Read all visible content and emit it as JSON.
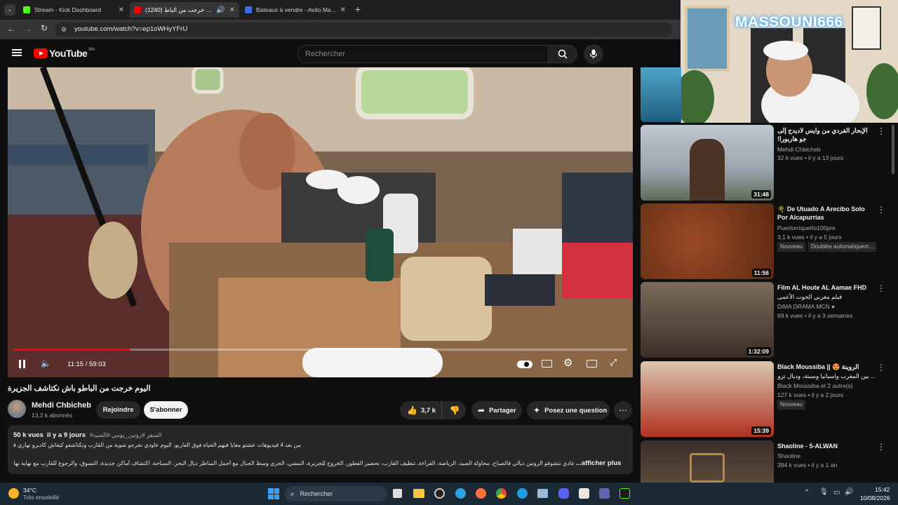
{
  "browser": {
    "tabs": [
      {
        "title": "Stream - Kick Dashboard",
        "favicon_color": "#53fc18"
      },
      {
        "title": "اليوم خرجت من الباط (1240)",
        "favicon_color": "#ff0000"
      },
      {
        "title": "Bateaux à vendre - Avito Maroc",
        "favicon_color": "#3a6df0"
      }
    ],
    "url": "youtube.com/watch?v=ep1oWHyYFrU"
  },
  "youtube": {
    "logo": "YouTube",
    "country": "MA",
    "search_placeholder": "Rechercher"
  },
  "player": {
    "time": "11:15 / 59:03",
    "progress": 0.19
  },
  "video": {
    "title": "اليوم خرجت من الباطو باش نكتاشف الجزيرة",
    "channel": "Mehdi Chbicheb",
    "subscribers": "13,2 k abonnés",
    "join": "Rejoindre",
    "subscribe": "S'abonner",
    "likes": "3,7 k",
    "share": "Partager",
    "ask": "Posez une question",
    "views_date": "50 k vues  il y a 9 jours",
    "hashtags": "#السفر #روتين_يومي #الصيد",
    "desc1": "من بعد 4 فيديوهات عشتو معايا فيهم الحياة فوق الفاربو، اليوم عاودي نخرجو شوية من القارب ونكتاشفو كيفاش كاديرو نهاري فجزيرة كاناريا.",
    "desc2": "عادي نتشوفو الروتين ديالي فالصباح، محاولة الصيد، الرياضة، القراءة، تنظيف القارب، تحضير الفطور، الخروج للجزيرة، المشي، الجري وسط الجبال مع أجمل المناظر ديال البحر، السباحة، اكتشاف أماكن جديدة، التسوق، والرجوع للقارب مع نهاية نهار مليان بالمغامرات.",
    "more": "...afficher plus"
  },
  "overlay": {
    "streamer": "MASSOUNI666"
  },
  "recommendations": [
    {
      "title": "الإبحار الفردي من وايس لاديدج إلى جو هاربورا!",
      "channel": "Mehdi Chbicheb",
      "meta": "32 k vues • il y a 13 jours",
      "duration": "31:48"
    },
    {
      "title": "🌴 De Utuado A Arecibo Solo Por Alcapurrias",
      "channel": "Puertorriqueño100pre",
      "meta": "3,1 k vues • il y a 5 jours",
      "duration": "11:56",
      "badges": [
        "Nouveau",
        "Doublée automatiquem..."
      ]
    },
    {
      "title": "Film AL Houte AL Aamae FHD",
      "title2": "فيلم مغربي الحوت الأعمى",
      "channel": "DiMA DRAMA MCN",
      "meta": "69 k vues • il y a 3 semaines",
      "duration": "1:32:09"
    },
    {
      "title": "Black Moussiba || 😍 الروينة",
      "title2": "... بين المغرب واسبانيا وسبتة، وديال تزوج",
      "channel": "Black Moussiba",
      "channel_extra": "et 2 autre(s)",
      "meta": "127 k vues • il y a 2 jours",
      "duration": "15:39",
      "badges": [
        "Nouveau"
      ]
    },
    {
      "title": "Shaoline - 5-ALWAN",
      "channel": "Shaoline",
      "meta": "394 k vues • il y a 1 an"
    }
  ],
  "taskbar": {
    "weather_temp": "34°C",
    "weather_text": "Très ensoleillé",
    "search": "Rechercher",
    "time": "15:42",
    "date": "10/08/2026"
  }
}
